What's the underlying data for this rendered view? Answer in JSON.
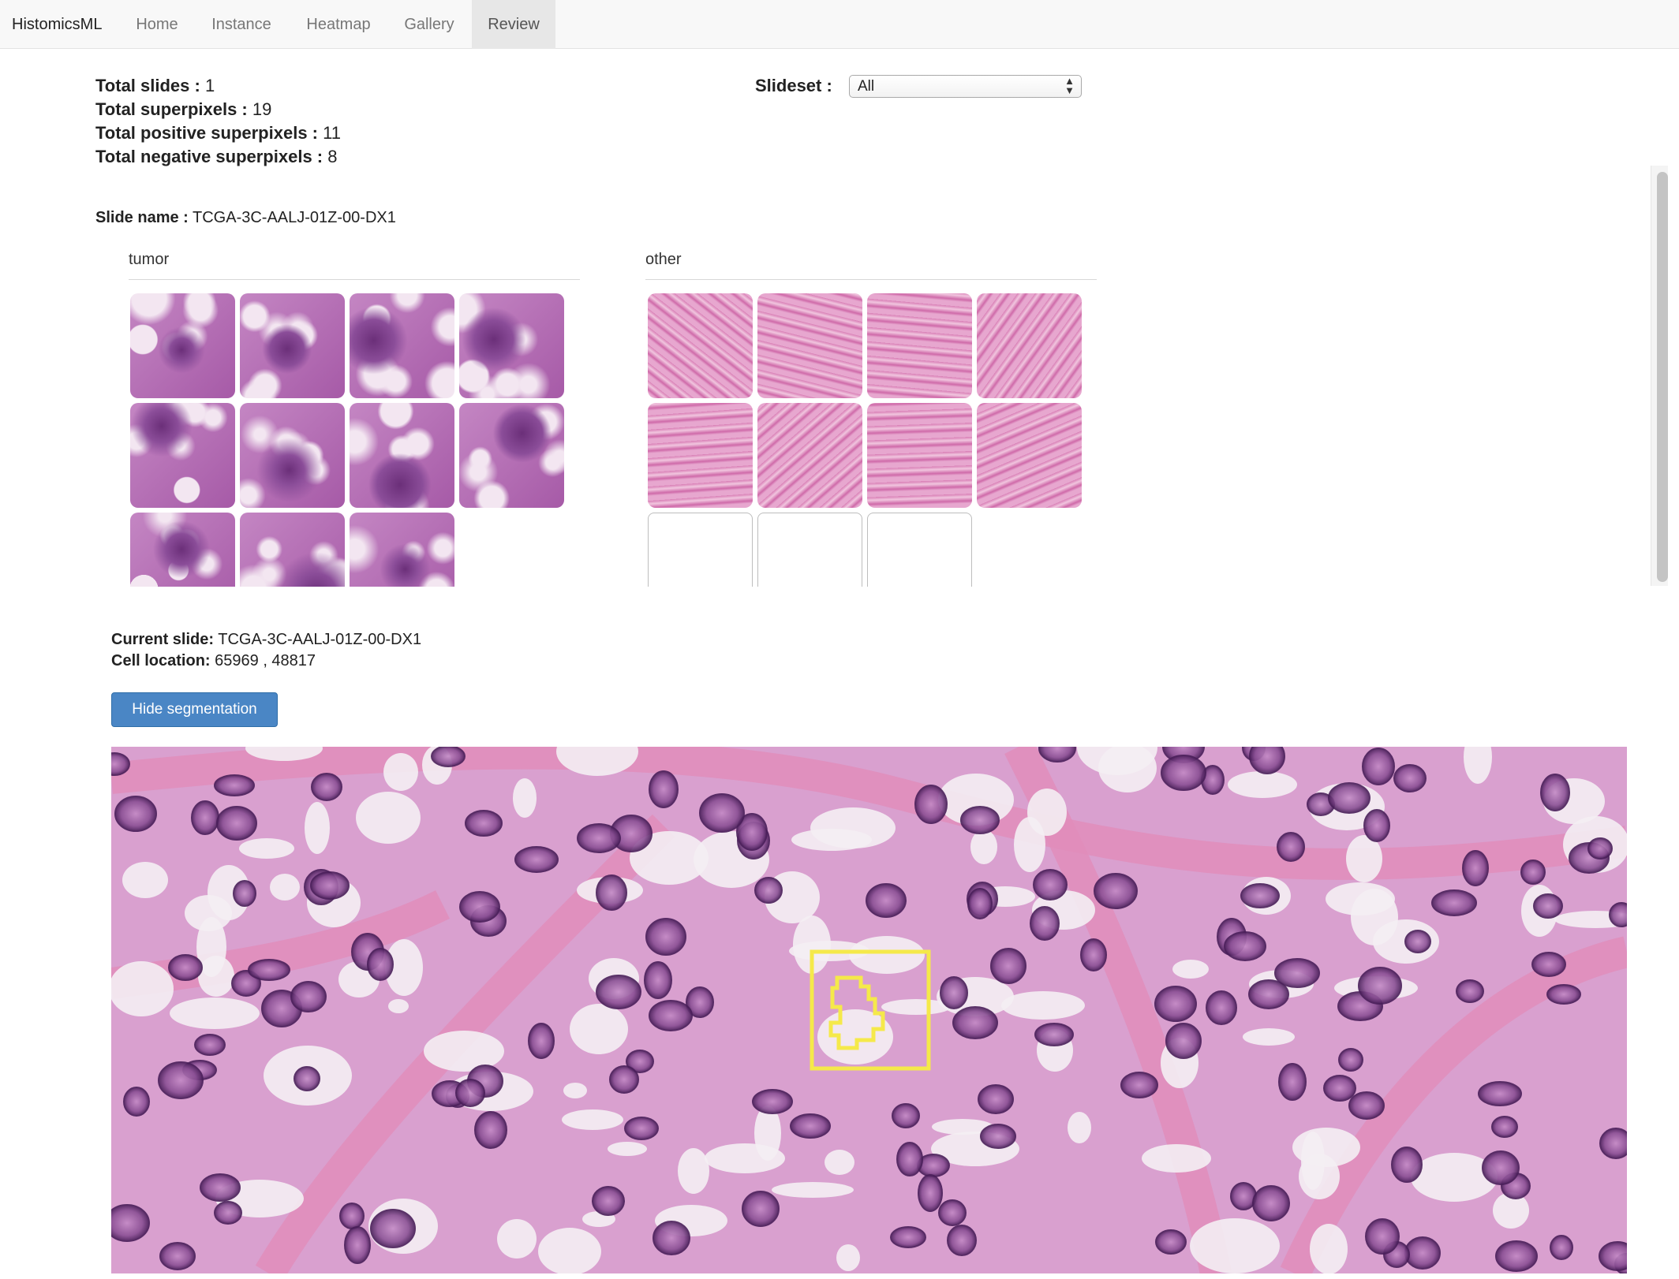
{
  "nav": {
    "brand": "HistomicsML",
    "items": [
      {
        "label": "Home"
      },
      {
        "label": "Instance"
      },
      {
        "label": "Heatmap"
      },
      {
        "label": "Gallery"
      },
      {
        "label": "Review"
      }
    ],
    "active": "Review"
  },
  "stats": {
    "total_slides_label": "Total slides :",
    "total_slides": "1",
    "total_superpixels_label": "Total superpixels :",
    "total_superpixels": "19",
    "total_positive_label": "Total positive superpixels :",
    "total_positive": "11",
    "total_negative_label": "Total negative superpixels :",
    "total_negative": "8"
  },
  "slideset": {
    "label": "Slideset :",
    "selected": "All"
  },
  "review": {
    "slide_name_label": "Slide name :",
    "slide_name": "TCGA-3C-AALJ-01Z-00-DX1",
    "classes": [
      {
        "name": "tumor",
        "thumbnails": 11
      },
      {
        "name": "other",
        "thumbnails": 8,
        "empty_slots": 3
      }
    ]
  },
  "current": {
    "slide_label": "Current slide:",
    "slide": "TCGA-3C-AALJ-01Z-00-DX1",
    "location_label": "Cell location:",
    "location": "65969 , 48817"
  },
  "buttons": {
    "hide_segmentation": "Hide segmentation"
  },
  "colors": {
    "accent": "#4a86c5",
    "segmentation": "#f5e94a",
    "tissue_base": "#d79bcb",
    "nucleus": "#5b2a6b"
  },
  "icons": {
    "select_arrows": "updown-arrows-icon"
  }
}
